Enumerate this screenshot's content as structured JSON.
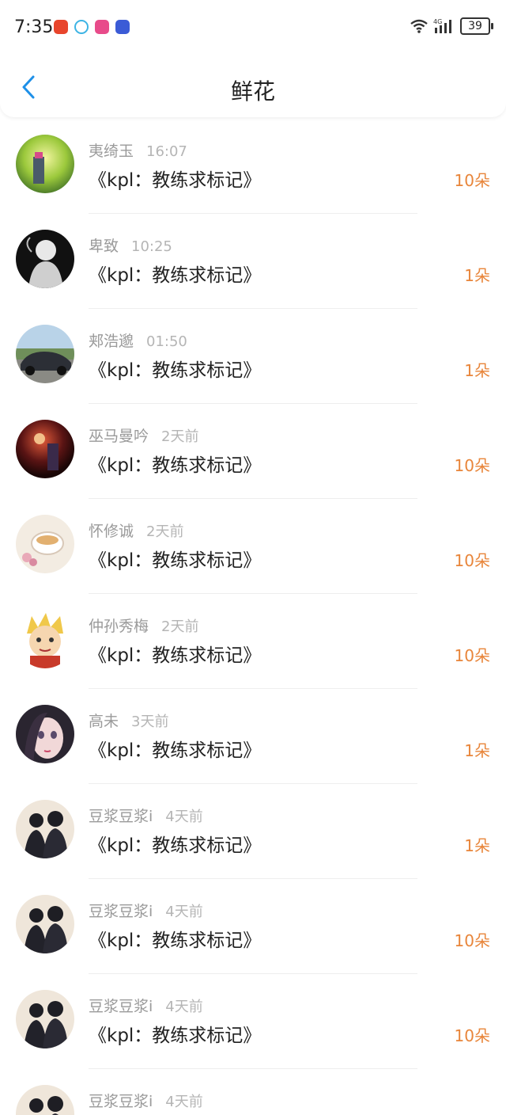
{
  "status_bar": {
    "time": "7:35",
    "battery": "39",
    "signal_label": "4G",
    "app_icon_colors": [
      "#e8452c",
      "#3db4e4",
      "#e84b8a",
      "#3b5bd6"
    ]
  },
  "header": {
    "title": "鲜花"
  },
  "colors": {
    "accent": "#1e90e8",
    "count": "#e8853a"
  },
  "rows": [
    {
      "name": "夷绮玉",
      "time": "16:07",
      "message": "《kpl：教练求标记》",
      "count": "10朵",
      "avatar": "landscape-green"
    },
    {
      "name": "卑致",
      "time": "10:25",
      "message": "《kpl：教练求标记》",
      "count": "1朵",
      "avatar": "anime-dark"
    },
    {
      "name": "郏浩邈",
      "time": "01:50",
      "message": "《kpl：教练求标记》",
      "count": "1朵",
      "avatar": "car"
    },
    {
      "name": "巫马曼吟",
      "time": "2天前",
      "message": "《kpl：教练求标记》",
      "count": "10朵",
      "avatar": "dark-red"
    },
    {
      "name": "怀修诚",
      "time": "2天前",
      "message": "《kpl：教练求标记》",
      "count": "10朵",
      "avatar": "teacup"
    },
    {
      "name": "仲孙秀梅",
      "time": "2天前",
      "message": "《kpl：教练求标记》",
      "count": "10朵",
      "avatar": "anime-blonde"
    },
    {
      "name": "高未",
      "time": "3天前",
      "message": "《kpl：教练求标记》",
      "count": "1朵",
      "avatar": "anime-girl"
    },
    {
      "name": "豆浆豆浆i",
      "time": "4天前",
      "message": "《kpl：教练求标记》",
      "count": "1朵",
      "avatar": "people"
    },
    {
      "name": "豆浆豆浆i",
      "time": "4天前",
      "message": "《kpl：教练求标记》",
      "count": "10朵",
      "avatar": "people"
    },
    {
      "name": "豆浆豆浆i",
      "time": "4天前",
      "message": "《kpl：教练求标记》",
      "count": "10朵",
      "avatar": "people"
    },
    {
      "name": "豆浆豆浆i",
      "time": "4天前",
      "message": "",
      "count": "",
      "avatar": "people"
    }
  ]
}
